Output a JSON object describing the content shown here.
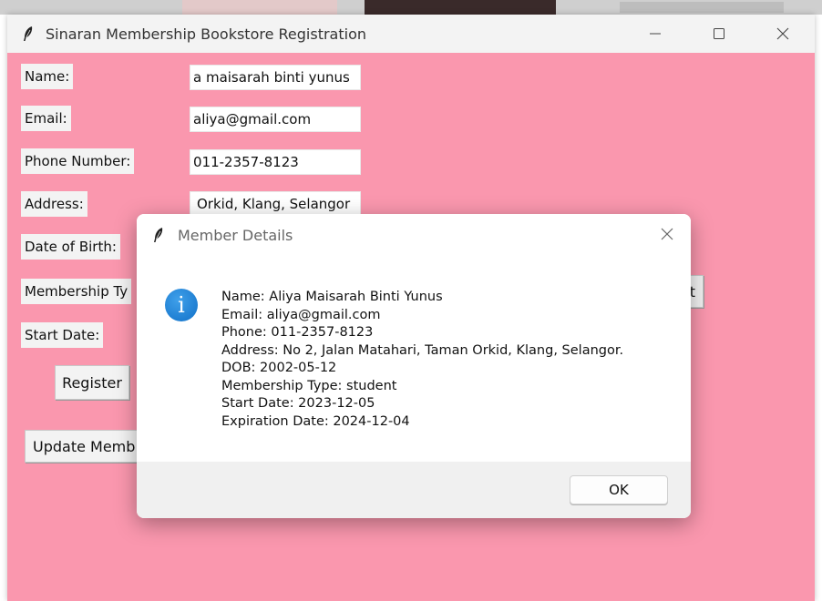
{
  "window": {
    "title": "Sinaran Membership Bookstore Registration",
    "icons": {
      "app": "feather-icon",
      "minimize": "minimize-icon",
      "maximize": "maximize-icon",
      "close": "close-icon"
    },
    "colors": {
      "background": "#fa97ae",
      "titlebar": "#f3f3f3"
    }
  },
  "form": {
    "labels": {
      "name": "Name:",
      "email": "Email:",
      "phone": "Phone Number:",
      "address": "Address:",
      "dob": "Date of Birth:",
      "membership_type": "Membership Ty",
      "start_date": "Start Date:"
    },
    "values": {
      "name": "a maisarah binti yunus",
      "email": "aliya@gmail.com",
      "phone": "011-2357-8123",
      "address": "Orkid, Klang, Selangor"
    },
    "buttons": {
      "register": "Register",
      "update": "Update Memb",
      "partial_right": "t"
    }
  },
  "dialog": {
    "title": "Member Details",
    "icon": "info-icon",
    "icon_glyph": "i",
    "lines": [
      "Name: Aliya Maisarah Binti Yunus",
      "Email: aliya@gmail.com",
      "Phone: 011-2357-8123",
      "Address: No 2, Jalan Matahari, Taman Orkid, Klang, Selangor.",
      "DOB: 2002-05-12",
      "Membership Type: student",
      "Start Date: 2023-12-05",
      "Expiration Date: 2024-12-04"
    ],
    "ok_label": "OK"
  }
}
